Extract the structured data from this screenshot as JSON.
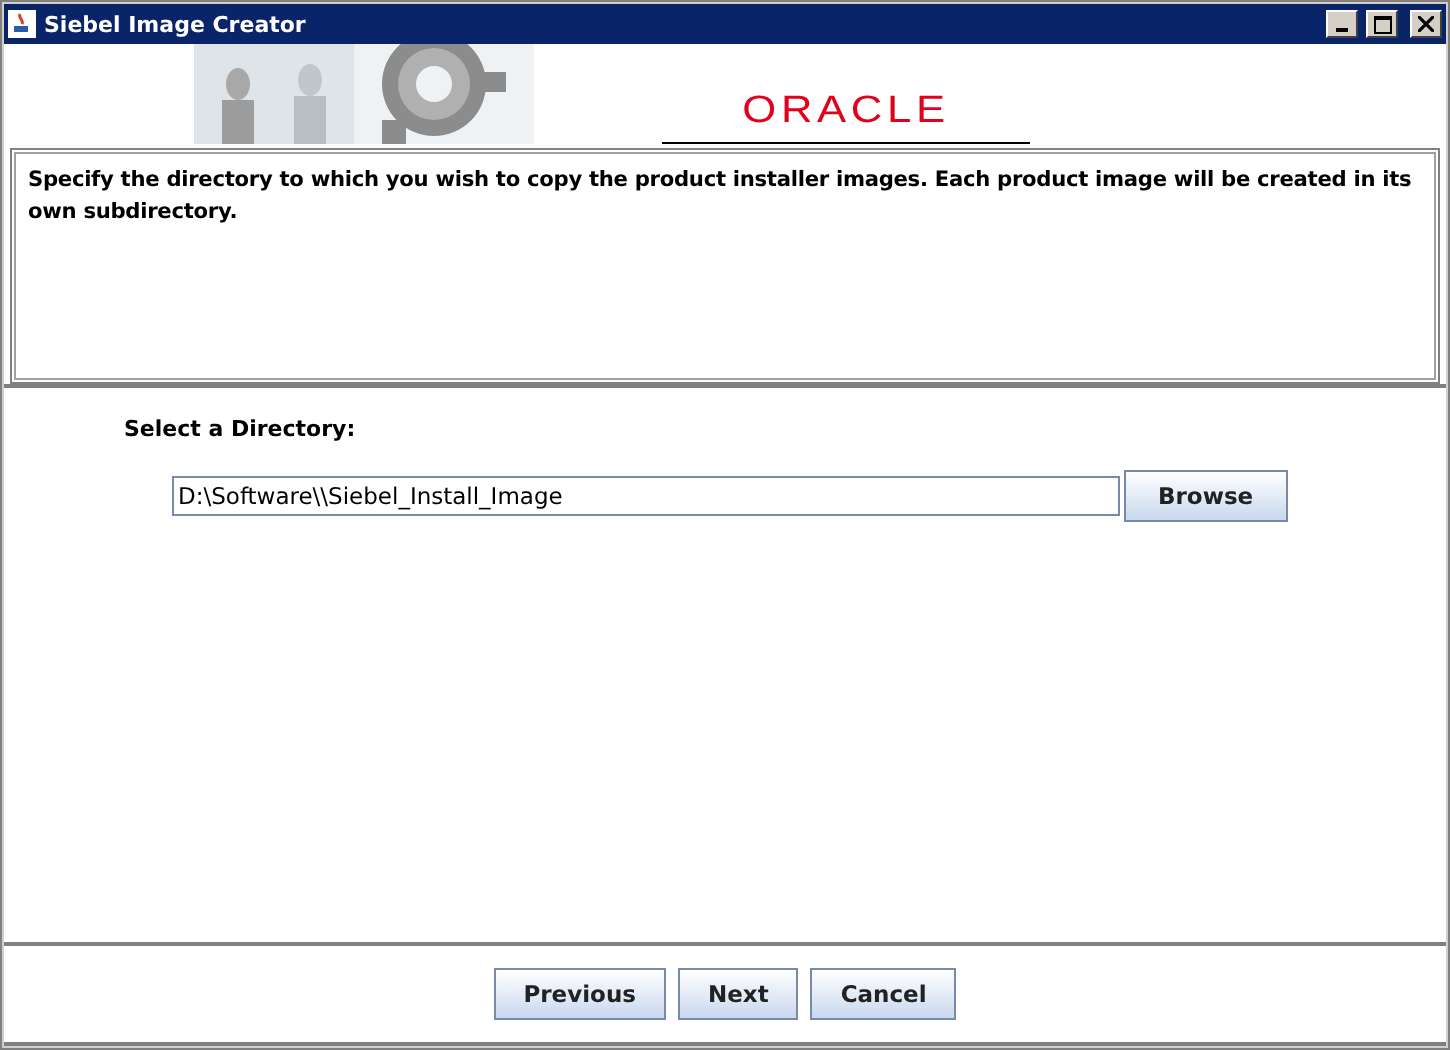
{
  "window": {
    "title": "Siebel Image Creator"
  },
  "banner": {
    "logo": "ORACLE"
  },
  "description": "Specify the directory to which you wish to copy the product installer images.  Each product image will be created in its own subdirectory.",
  "directory": {
    "label": "Select a Directory:",
    "value": "D:\\Software\\\\Siebel_Install_Image"
  },
  "browse_button": "Browse",
  "buttons": [
    "Previous",
    "Next",
    "Cancel"
  ]
}
